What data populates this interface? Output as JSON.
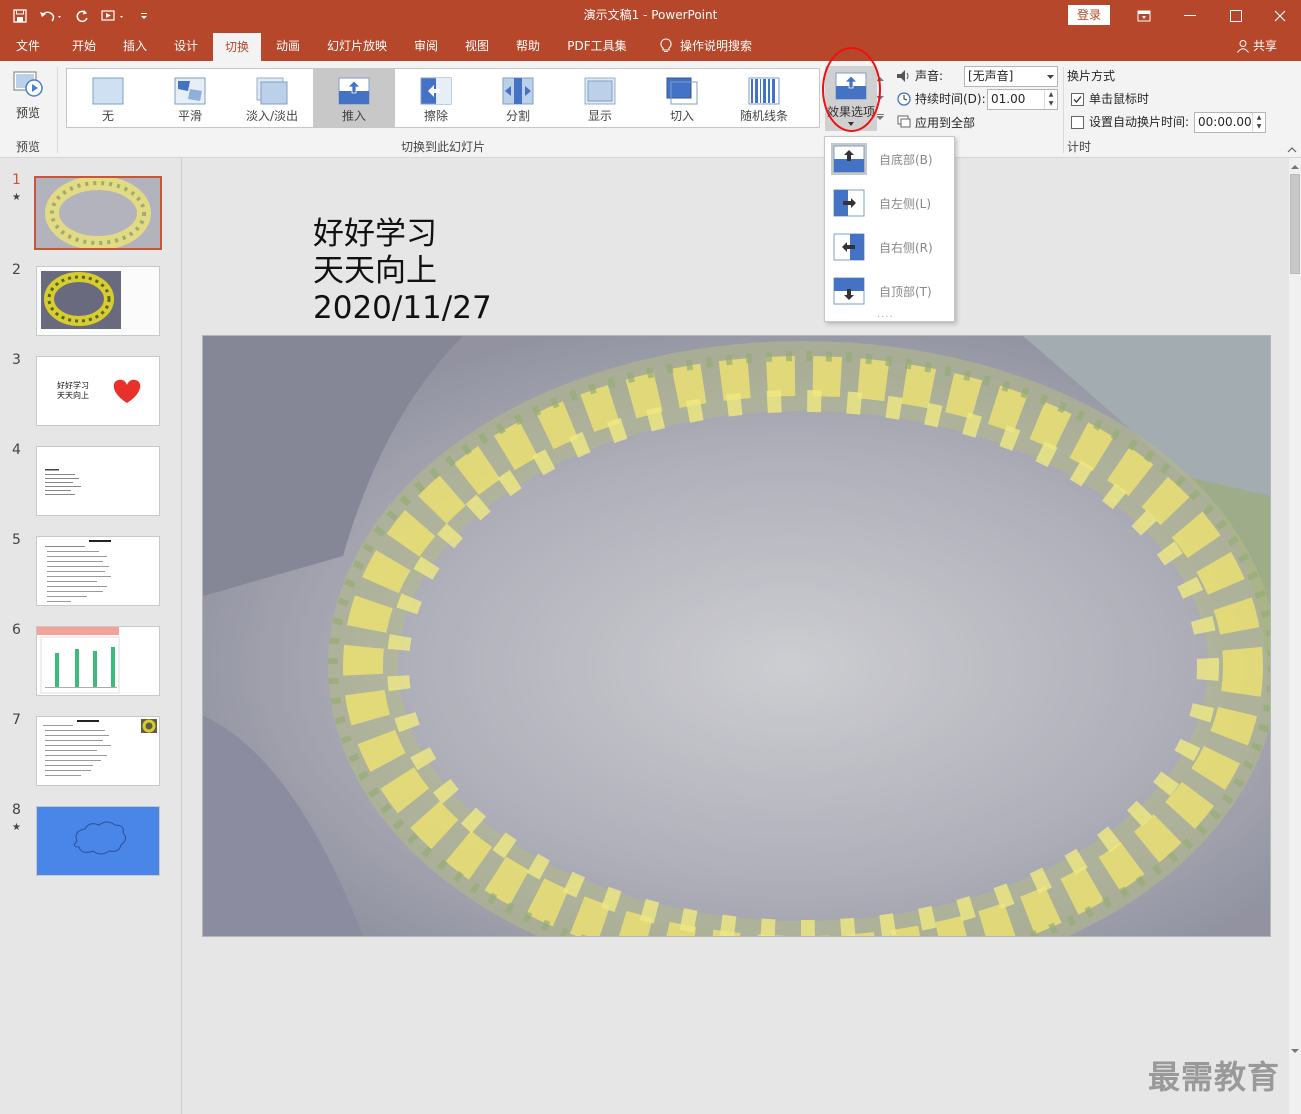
{
  "window": {
    "title": "演示文稿1  -  PowerPoint",
    "login_label": "登录"
  },
  "tabs": [
    {
      "label": "文件"
    },
    {
      "label": "开始"
    },
    {
      "label": "插入"
    },
    {
      "label": "设计"
    },
    {
      "label": "切换",
      "active": true
    },
    {
      "label": "动画"
    },
    {
      "label": "幻灯片放映"
    },
    {
      "label": "审阅"
    },
    {
      "label": "视图"
    },
    {
      "label": "帮助"
    },
    {
      "label": "PDF工具集"
    },
    {
      "label": "操作说明搜索"
    }
  ],
  "share_label": "共享",
  "ribbon": {
    "preview": {
      "button_label": "预览",
      "group_label": "预览"
    },
    "transitions": {
      "group_label": "切换到此幻灯片",
      "items": [
        "无",
        "平滑",
        "淡入/淡出",
        "推入",
        "擦除",
        "分割",
        "显示",
        "切入",
        "随机线条"
      ],
      "selected": "推入"
    },
    "effect_options_label": "效果选项",
    "timing": {
      "group_label": "计时",
      "sound_label": "声音:",
      "sound_value": "[无声音]",
      "duration_label": "持续时间(D):",
      "duration_value": "01.00",
      "apply_all_label": "应用到全部",
      "advance_title": "换片方式",
      "on_click_label": "单击鼠标时",
      "on_click_checked": true,
      "after_label": "设置自动换片时间:",
      "after_value": "00:00.00",
      "after_checked": false
    }
  },
  "effect_menu": {
    "items": [
      {
        "label": "自底部(B)",
        "selected": true
      },
      {
        "label": "自左侧(L)"
      },
      {
        "label": "自右侧(R)"
      },
      {
        "label": "自顶部(T)"
      }
    ],
    "more": "....",
    "colors": {
      "blue": "#4472c4",
      "light": "#bcd0ea"
    }
  },
  "slides": [
    {
      "num": "1",
      "star": "★",
      "text": ""
    },
    {
      "num": "2",
      "star": "",
      "text": ""
    },
    {
      "num": "3",
      "star": "",
      "text": "好好学习\n天天向上"
    },
    {
      "num": "4",
      "star": "",
      "text": ""
    },
    {
      "num": "5",
      "star": "",
      "text": ""
    },
    {
      "num": "6",
      "star": "",
      "text": ""
    },
    {
      "num": "7",
      "star": "",
      "text": ""
    },
    {
      "num": "8",
      "star": "★",
      "text": ""
    }
  ],
  "slide": {
    "line1": "好好学习",
    "line2": "天天向上",
    "line3": "2020/11/27"
  },
  "watermark": "最需教育",
  "colors": {
    "brand": "#b7472a",
    "selection_border": "#c4573a",
    "slide8_bg": "#4a86e8"
  }
}
